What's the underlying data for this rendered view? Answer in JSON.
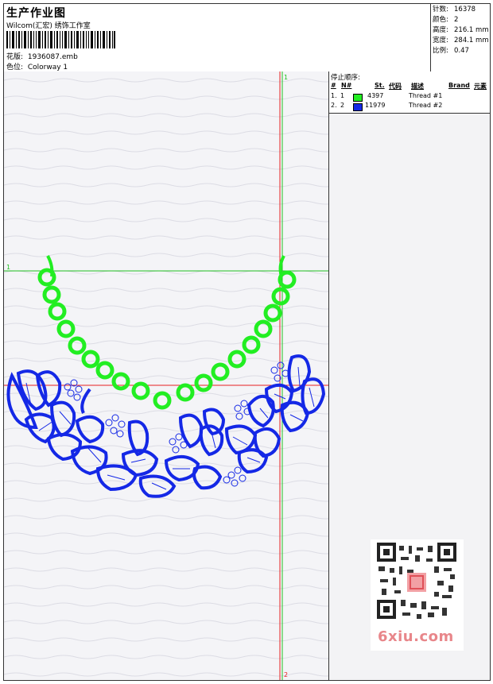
{
  "header": {
    "title": "生产作业图",
    "subtitle": "Wilcom(汇宏) 绣饰工作室",
    "design_label": "花版:",
    "design_value": "1936087.emb",
    "colorway_label": "色位:",
    "colorway_value": "Colorway 1"
  },
  "stats": [
    {
      "label": "针数:",
      "value": "16378"
    },
    {
      "label": "颜色:",
      "value": "2"
    },
    {
      "label": "高度:",
      "value": "216.1 mm"
    },
    {
      "label": "宽度:",
      "value": "284.1 mm"
    },
    {
      "label": "比例:",
      "value": "0.47"
    }
  ],
  "sequence": {
    "title": "停止顺序:",
    "columns": {
      "num": "#",
      "n": "N#",
      "stitches": "St.",
      "code": "代码",
      "desc": "描述",
      "brand": "Brand",
      "element": "元素"
    },
    "rows": [
      {
        "num": "1.",
        "n": "1",
        "color": "#22ee22",
        "code": "4397",
        "desc": "Thread #1"
      },
      {
        "num": "2.",
        "n": "2",
        "color": "#1428e6",
        "code": "11979",
        "desc": "Thread #2"
      }
    ]
  },
  "guides": {
    "top_v": "1",
    "bottom_v": "2",
    "left_h": "1"
  },
  "watermark": {
    "text": "6xiu.com"
  },
  "colors": {
    "green": "#22ee22",
    "blue": "#1428e6",
    "red_guide": "#e62020",
    "green_guide": "#20c020"
  }
}
